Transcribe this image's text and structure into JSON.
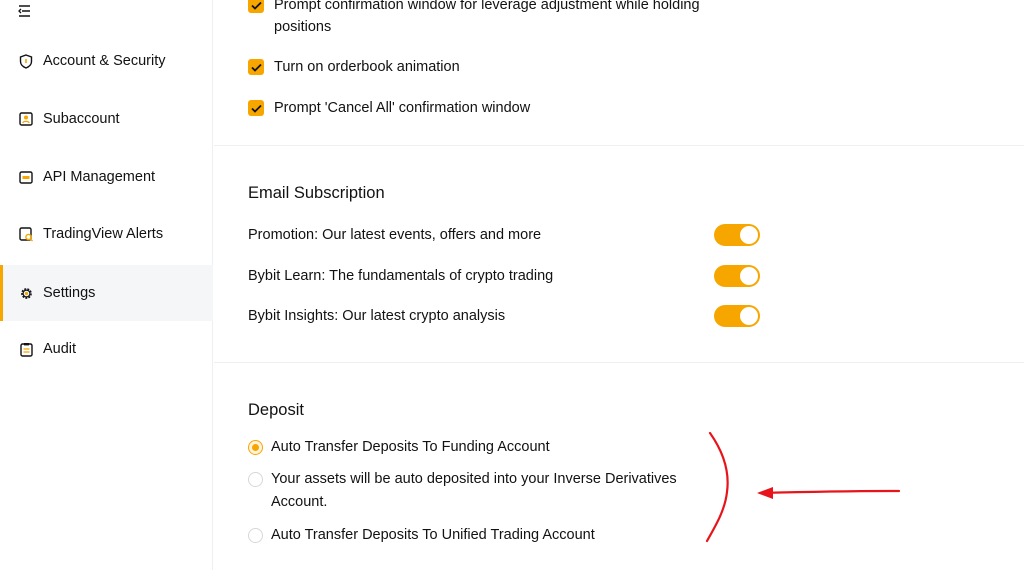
{
  "sidebar": {
    "items": [
      {
        "label": "Account & Security",
        "icon": "shield-icon"
      },
      {
        "label": "Subaccount",
        "icon": "subaccount-icon"
      },
      {
        "label": "API Management",
        "icon": "api-icon"
      },
      {
        "label": "TradingView Alerts",
        "icon": "alert-icon"
      },
      {
        "label": "Settings",
        "icon": "gear-icon",
        "active": true
      },
      {
        "label": "Audit",
        "icon": "clipboard-icon"
      }
    ]
  },
  "preferences": {
    "items": [
      {
        "label": "Prompt confirmation window for leverage adjustment while holding positions",
        "checked": true
      },
      {
        "label": "Turn on orderbook animation",
        "checked": true
      },
      {
        "label": "Prompt 'Cancel All' confirmation window",
        "checked": true
      }
    ]
  },
  "email": {
    "title": "Email Subscription",
    "items": [
      {
        "label": "Promotion: Our latest events, offers and more",
        "on": true
      },
      {
        "label": "Bybit Learn: The fundamentals of crypto trading",
        "on": true
      },
      {
        "label": "Bybit Insights: Our latest crypto analysis",
        "on": true
      }
    ]
  },
  "deposit": {
    "title": "Deposit",
    "options": [
      {
        "label": "Auto Transfer Deposits To Funding Account",
        "selected": true
      },
      {
        "label": "Your assets will be auto deposited into your Inverse Derivatives Account.",
        "selected": false
      },
      {
        "label": "Auto Transfer Deposits To Unified Trading Account",
        "selected": false
      }
    ]
  },
  "colors": {
    "accent": "#f7a600",
    "annotation": "#e8141b"
  }
}
